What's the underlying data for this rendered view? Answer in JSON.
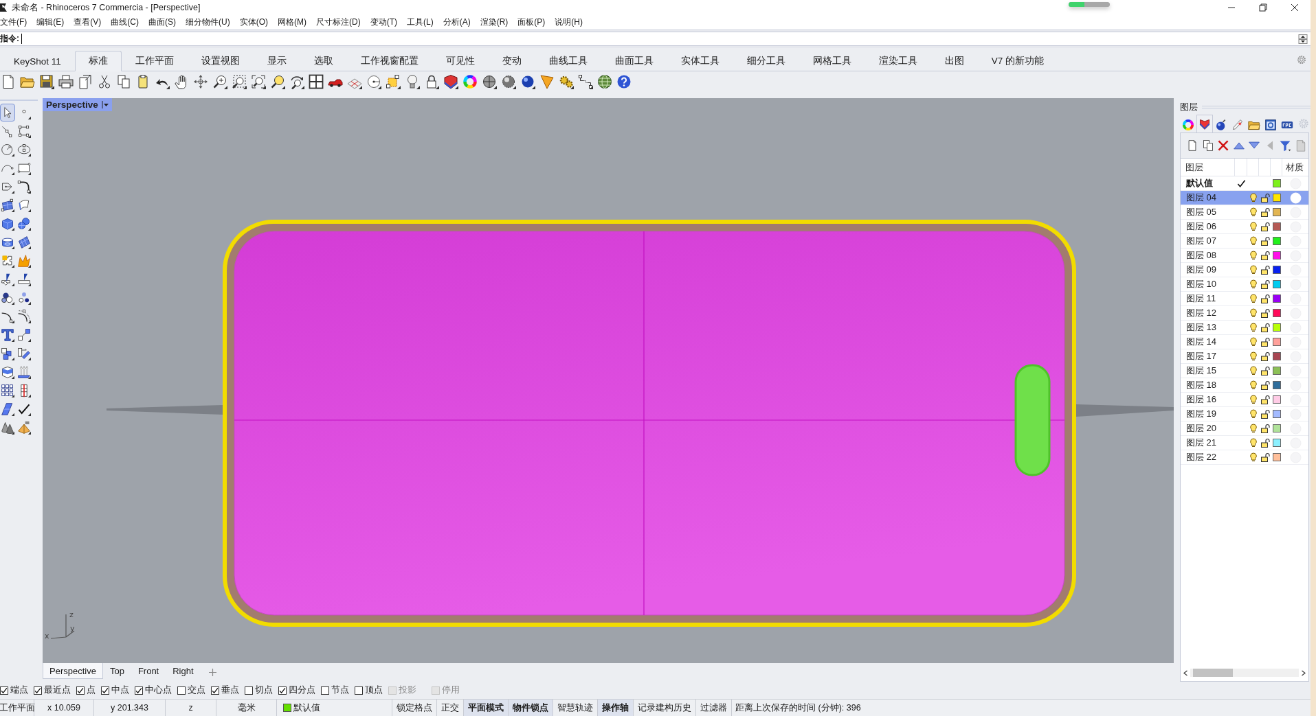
{
  "window": {
    "title": "未命名 - Rhinoceros 7 Commercia - [Perspective]",
    "progress": {
      "level": 0.38
    }
  },
  "menu": [
    "文件(F)",
    "编辑(E)",
    "查看(V)",
    "曲线(C)",
    "曲面(S)",
    "细分物件(U)",
    "实体(O)",
    "网格(M)",
    "尺寸标注(D)",
    "变动(T)",
    "工具(L)",
    "分析(A)",
    "渲染(R)",
    "面板(P)",
    "说明(H)"
  ],
  "command": {
    "label": "指令:"
  },
  "tabs": [
    {
      "label": "KeyShot 11",
      "selected": false
    },
    {
      "label": "标准",
      "selected": true
    },
    {
      "label": "工作平面",
      "selected": false
    },
    {
      "label": "设置视图",
      "selected": false
    },
    {
      "label": "显示",
      "selected": false
    },
    {
      "label": "选取",
      "selected": false
    },
    {
      "label": "工作视窗配置",
      "selected": false
    },
    {
      "label": "可见性",
      "selected": false
    },
    {
      "label": "变动",
      "selected": false
    },
    {
      "label": "曲线工具",
      "selected": false
    },
    {
      "label": "曲面工具",
      "selected": false
    },
    {
      "label": "实体工具",
      "selected": false
    },
    {
      "label": "细分工具",
      "selected": false
    },
    {
      "label": "网格工具",
      "selected": false
    },
    {
      "label": "渲染工具",
      "selected": false
    },
    {
      "label": "出图",
      "selected": false
    },
    {
      "label": "V7 的新功能",
      "selected": false
    }
  ],
  "left_toolbar": {
    "tools": [
      {
        "selected": true
      },
      {
        "selected": false
      },
      {
        "selected": false
      },
      {
        "selected": false
      },
      {
        "selected": false
      },
      {
        "selected": false
      },
      {
        "selected": false
      },
      {
        "selected": false
      },
      {
        "selected": false
      },
      {
        "selected": false
      },
      {
        "selected": false
      },
      {
        "selected": false
      },
      {
        "selected": false
      },
      {
        "selected": false
      },
      {
        "selected": false
      },
      {
        "selected": false
      },
      {
        "selected": false
      },
      {
        "selected": false
      },
      {
        "selected": false
      },
      {
        "selected": false
      },
      {
        "selected": false
      },
      {
        "selected": false
      },
      {
        "selected": false
      },
      {
        "selected": false
      },
      {
        "selected": false
      },
      {
        "selected": false
      },
      {
        "selected": false
      },
      {
        "selected": false
      },
      {
        "selected": false
      },
      {
        "selected": false
      },
      {
        "selected": false
      },
      {
        "selected": false
      },
      {
        "selected": false
      },
      {
        "selected": false
      },
      {
        "selected": false
      },
      {
        "selected": false
      }
    ]
  },
  "viewport": {
    "label": "Perspective",
    "axis_labels": [
      "z",
      "y",
      "x"
    ]
  },
  "viewport_tabs": [
    {
      "label": "Perspective",
      "selected": true
    },
    {
      "label": "Top",
      "selected": false
    },
    {
      "label": "Front",
      "selected": false
    },
    {
      "label": "Right",
      "selected": false
    }
  ],
  "layers_panel": {
    "title": "图层",
    "tabs": [
      {
        "selected": false
      },
      {
        "selected": true
      },
      {
        "selected": false
      },
      {
        "selected": false
      },
      {
        "selected": false
      },
      {
        "selected": false
      },
      {
        "selected": false
      }
    ],
    "tools": [
      {
        "disabled": false
      },
      {
        "disabled": false
      },
      {
        "disabled": false
      },
      {
        "disabled": false
      },
      {
        "disabled": false
      },
      {
        "disabled": true
      },
      {
        "disabled": false
      },
      {
        "disabled": true
      }
    ],
    "columns": [
      "图层",
      "材质"
    ],
    "rows": [
      {
        "kind": "default",
        "name": "默认值",
        "current": true,
        "selected": false,
        "color": "#7ef01c"
      },
      {
        "kind": "layer",
        "name": "图层 04",
        "current": false,
        "selected": true,
        "visible": true,
        "locked": false,
        "color": "#ffe600"
      },
      {
        "kind": "layer",
        "name": "图层 05",
        "current": false,
        "selected": false,
        "visible": true,
        "locked": false,
        "color": "#e2b552"
      },
      {
        "kind": "layer",
        "name": "图层 06",
        "current": false,
        "selected": false,
        "visible": true,
        "locked": false,
        "color": "#b55a55"
      },
      {
        "kind": "layer",
        "name": "图层 07",
        "current": false,
        "selected": false,
        "visible": true,
        "locked": false,
        "color": "#22f01c"
      },
      {
        "kind": "layer",
        "name": "图层 08",
        "current": false,
        "selected": false,
        "visible": true,
        "locked": false,
        "color": "#ff10e8"
      },
      {
        "kind": "layer",
        "name": "图层 09",
        "current": false,
        "selected": false,
        "visible": true,
        "locked": false,
        "color": "#0820f0"
      },
      {
        "kind": "layer",
        "name": "图层 10",
        "current": false,
        "selected": false,
        "visible": true,
        "locked": false,
        "color": "#00ccf0"
      },
      {
        "kind": "layer",
        "name": "图层 11",
        "current": false,
        "selected": false,
        "visible": true,
        "locked": false,
        "color": "#9a00f5"
      },
      {
        "kind": "layer",
        "name": "图层 12",
        "current": false,
        "selected": false,
        "visible": true,
        "locked": false,
        "color": "#ff0a5a"
      },
      {
        "kind": "layer",
        "name": "图层 13",
        "current": false,
        "selected": false,
        "visible": true,
        "locked": false,
        "color": "#b8ff0a"
      },
      {
        "kind": "layer",
        "name": "图层 14",
        "current": false,
        "selected": false,
        "visible": true,
        "locked": false,
        "color": "#ffa09a"
      },
      {
        "kind": "layer",
        "name": "图层 17",
        "current": false,
        "selected": false,
        "visible": true,
        "locked": false,
        "color": "#a84652"
      },
      {
        "kind": "layer",
        "name": "图层 15",
        "current": false,
        "selected": false,
        "visible": true,
        "locked": false,
        "color": "#8cc056"
      },
      {
        "kind": "layer",
        "name": "图层 18",
        "current": false,
        "selected": false,
        "visible": true,
        "locked": false,
        "color": "#2f6e9c"
      },
      {
        "kind": "layer",
        "name": "图层 16",
        "current": false,
        "selected": false,
        "visible": true,
        "locked": false,
        "color": "#ffcce6"
      },
      {
        "kind": "layer",
        "name": "图层 19",
        "current": false,
        "selected": false,
        "visible": true,
        "locked": false,
        "color": "#a3baff"
      },
      {
        "kind": "layer",
        "name": "图层 20",
        "current": false,
        "selected": false,
        "visible": true,
        "locked": false,
        "color": "#b0e29a"
      },
      {
        "kind": "layer",
        "name": "图层 21",
        "current": false,
        "selected": false,
        "visible": true,
        "locked": false,
        "color": "#8cf0ff"
      },
      {
        "kind": "layer",
        "name": "图层 22",
        "current": false,
        "selected": false,
        "visible": true,
        "locked": false,
        "color": "#ffbf9a"
      }
    ]
  },
  "osnaps": [
    {
      "label": "端点",
      "checked": true,
      "disabled": false
    },
    {
      "label": "最近点",
      "checked": true,
      "disabled": false
    },
    {
      "label": "点",
      "checked": true,
      "disabled": false
    },
    {
      "label": "中点",
      "checked": true,
      "disabled": false
    },
    {
      "label": "中心点",
      "checked": true,
      "disabled": false
    },
    {
      "label": "交点",
      "checked": false,
      "disabled": false
    },
    {
      "label": "垂点",
      "checked": true,
      "disabled": false
    },
    {
      "label": "切点",
      "checked": false,
      "disabled": false
    },
    {
      "label": "四分点",
      "checked": true,
      "disabled": false
    },
    {
      "label": "节点",
      "checked": false,
      "disabled": false
    },
    {
      "label": "顶点",
      "checked": false,
      "disabled": false
    },
    {
      "label": "投影",
      "checked": false,
      "disabled": true
    }
  ],
  "osnap_disable": {
    "label": "停用",
    "checked": false,
    "disabled": true
  },
  "status_bar": {
    "cplane": "工作平面",
    "x": "x 10.059",
    "y": "y 201.343",
    "z": "z",
    "units": "毫米",
    "layer": {
      "name": "默认值",
      "color": "#66e000"
    },
    "toggles": [
      {
        "label": "锁定格点",
        "on": false
      },
      {
        "label": "正交",
        "on": false
      },
      {
        "label": "平面模式",
        "on": true
      },
      {
        "label": "物件锁点",
        "on": true
      },
      {
        "label": "智慧轨迹",
        "on": false
      },
      {
        "label": "操作轴",
        "on": true
      },
      {
        "label": "记录建构历史",
        "on": false
      },
      {
        "label": "过滤器",
        "on": false
      }
    ],
    "save_time": "距离上次保存的时间 (分钟): 396"
  }
}
